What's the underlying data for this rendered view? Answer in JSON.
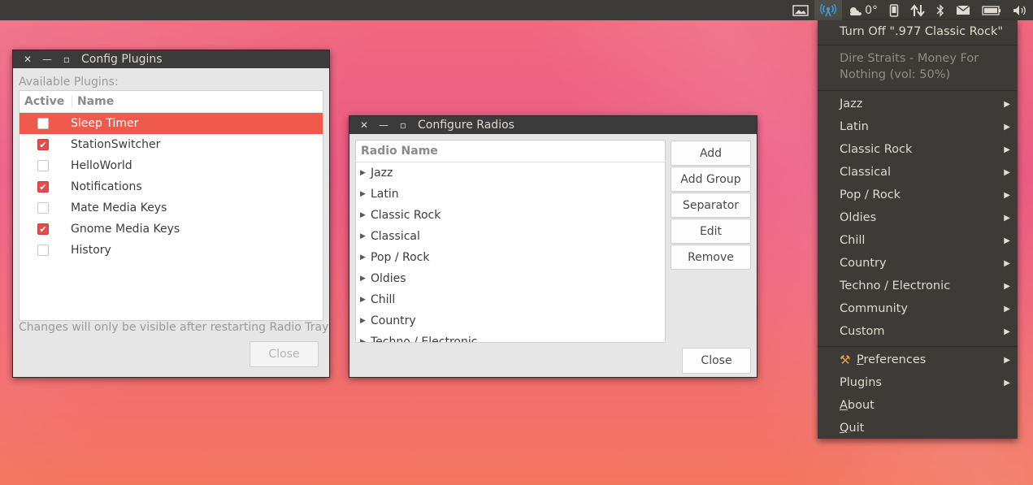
{
  "tray": {
    "temperature": "0°",
    "icons": [
      "display-icon",
      "radio-tray-icon",
      "weather-icon",
      "phone-icon",
      "network-icon",
      "bluetooth-icon",
      "mail-icon",
      "battery-icon",
      "volume-icon"
    ],
    "accent_color": "#35a5e8"
  },
  "plugins_window": {
    "title": "Config Plugins",
    "available_label": "Available Plugins:",
    "col_active": "Active",
    "col_name": "Name",
    "items": [
      {
        "name": "Sleep Timer",
        "active": false,
        "selected": true
      },
      {
        "name": "StationSwitcher",
        "active": true,
        "selected": false
      },
      {
        "name": "HelloWorld",
        "active": false,
        "selected": false
      },
      {
        "name": "Notifications",
        "active": true,
        "selected": false
      },
      {
        "name": "Mate Media Keys",
        "active": false,
        "selected": false
      },
      {
        "name": "Gnome Media Keys",
        "active": true,
        "selected": false
      },
      {
        "name": "History",
        "active": false,
        "selected": false
      }
    ],
    "footnote": "Changes will only be visible after restarting Radio Tray",
    "close_label": "Close",
    "selection_color": "#f05a4c"
  },
  "radios_window": {
    "title": "Configure Radios",
    "col_name": "Radio Name",
    "groups": [
      "Jazz",
      "Latin",
      "Classic Rock",
      "Classical",
      "Pop / Rock",
      "Oldies",
      "Chill",
      "Country",
      "Techno / Electronic"
    ],
    "buttons": {
      "add": "Add",
      "add_group": "Add Group",
      "separator": "Separator",
      "edit": "Edit",
      "remove": "Remove"
    },
    "close_label": "Close"
  },
  "menu": {
    "turn_off": "Turn Off \".977 Classic Rock\"",
    "now_playing_line1": "Dire Straits - Money For",
    "now_playing_line2": "Nothing (vol: 50%)",
    "groups": [
      "Jazz",
      "Latin",
      "Classic Rock",
      "Classical",
      "Pop / Rock",
      "Oldies",
      "Chill",
      "Country",
      "Techno / Electronic",
      "Community",
      "Custom"
    ],
    "preferences_first": "P",
    "preferences_rest": "references",
    "plugins": "Plugins",
    "about_first": "A",
    "about_rest": "bout",
    "quit_first": "Q",
    "quit_rest": "uit"
  }
}
